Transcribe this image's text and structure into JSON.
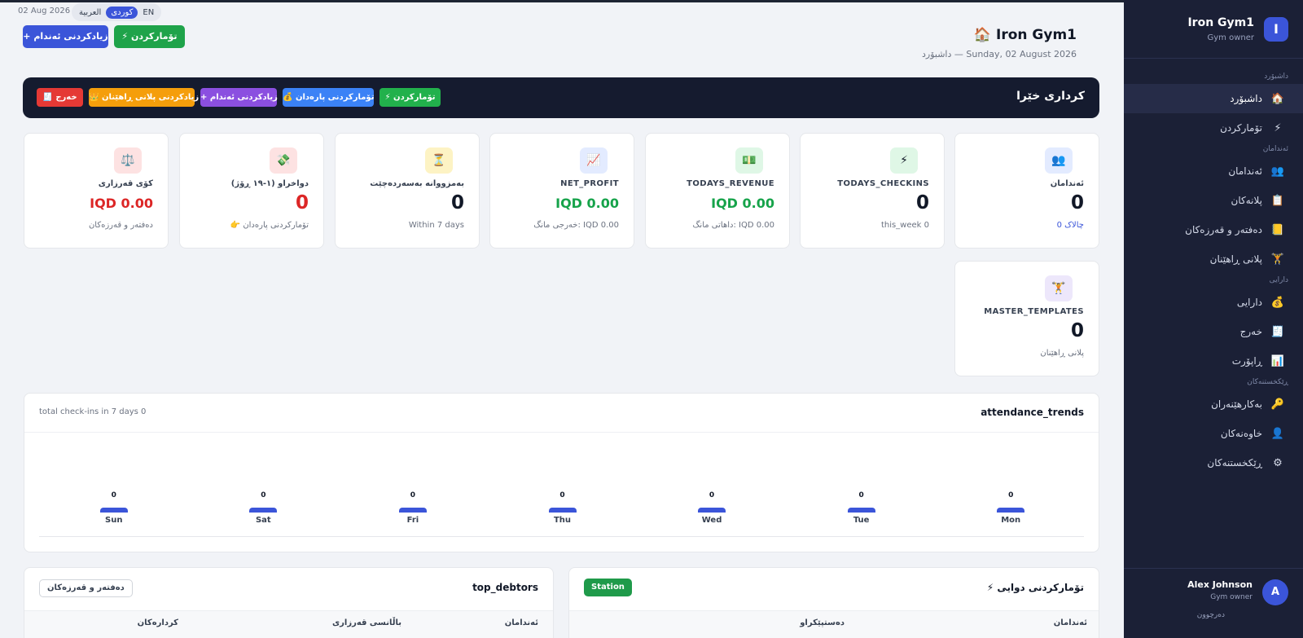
{
  "top": {
    "date": "02 Aug 2026",
    "languages": [
      "العربية",
      "کوردی",
      "EN"
    ],
    "active_language": "کوردی",
    "add_member_button": "+ زیادکردنی ئەندام",
    "checkin_button": "⚡ تۆمارکردن"
  },
  "header": {
    "title": "🏠 Iron Gym1",
    "subtitle": "داشبۆرد — Sunday, 02 August 2026"
  },
  "quick_actions": {
    "title": "کرداری خێرا",
    "buttons": [
      {
        "label": "⚡ تۆمارکردن",
        "color": "#22b14c"
      },
      {
        "label": "💰 تۆمارکردنی پارەدان",
        "color": "#3b82f6"
      },
      {
        "label": "+ زیادکردنی ئەندام",
        "color": "#8b4fe0"
      },
      {
        "label": "👑 زیادکردنی پلانی ڕاهێنان",
        "color": "#f59e0b"
      },
      {
        "label": "🧾 خەرج",
        "color": "#e53935"
      }
    ]
  },
  "stats": [
    {
      "icon": "👥",
      "label": "ئەندامان",
      "value": "0",
      "sub": "0 چالاک",
      "icon_bg": "#e3ebff",
      "color": "#111827"
    },
    {
      "icon": "⚡",
      "label": "TODAYS_CHECKINS",
      "value": "0",
      "sub": "this_week 0",
      "icon_bg": "#dff7e6",
      "color": "#111827"
    },
    {
      "icon": "💵",
      "label": "TODAYS_REVENUE",
      "value": "IQD 0.00",
      "sub": "داهاتی مانگ: IQD 0.00",
      "icon_bg": "#dff7e6",
      "color": "#16a34a"
    },
    {
      "icon": "📈",
      "label": "NET_PROFIT",
      "value": "IQD 0.00",
      "sub": "خەرجی مانگ: IQD 0.00",
      "icon_bg": "#e3ebff",
      "color": "#16a34a"
    },
    {
      "icon": "⏳",
      "label": "بەمزووانە بەسەردەچێت",
      "value": "0",
      "sub": "Within 7 days",
      "icon_bg": "#fdf3c4",
      "color": "#111827"
    },
    {
      "icon": "💸",
      "label": "دواخراو (۱-۱۹ ڕۆژ)",
      "value": "0",
      "sub": "👉 تۆمارکردنی پارەدان",
      "icon_bg": "#fde2e2",
      "color": "#dc2626"
    },
    {
      "icon": "⚖️",
      "label": "کۆی قەرزاری",
      "value": "IQD 0.00",
      "sub": "دەفتەر و قەرزەکان",
      "icon_bg": "#fde2e2",
      "color": "#dc2626"
    },
    {
      "icon": "🏋",
      "label": "MASTER_TEMPLATES",
      "value": "0",
      "sub": "پلانی ڕاهێنان",
      "icon_bg": "#ede7fb",
      "color": "#111827"
    }
  ],
  "attendance": {
    "title": "attendance_trends",
    "note": "total check-ins in 7 days 0"
  },
  "chart_data": {
    "type": "bar",
    "title": "attendance_trends",
    "categories": [
      "Mon",
      "Tue",
      "Wed",
      "Thu",
      "Fri",
      "Sat",
      "Sun"
    ],
    "values": [
      0,
      0,
      0,
      0,
      0,
      0,
      0
    ]
  },
  "recent_checkins": {
    "title": "⚡ تۆمارکردنی دوایی",
    "badge": "Station",
    "columns": [
      "ئەندامان",
      "دەستپێکراو"
    ]
  },
  "top_debtors": {
    "title": "top_debtors",
    "button": "دەفتەر و قەرزەکان",
    "columns": [
      "ئەندامان",
      "باڵانسی قەرزاری",
      "کردارەکان"
    ]
  },
  "sidebar": {
    "brand": "Iron Gym1",
    "role": "Gym owner",
    "logo_letter": "I",
    "sections": [
      {
        "title": "داشبۆرد",
        "items": [
          {
            "label": "داشبۆرد",
            "icon": "🏠",
            "active": true
          },
          {
            "label": "تۆمارکردن",
            "icon": "⚡"
          }
        ]
      },
      {
        "title": "ئەندامان",
        "items": [
          {
            "label": "ئەندامان",
            "icon": "👥"
          },
          {
            "label": "پلانەکان",
            "icon": "📋"
          },
          {
            "label": "دەفتەر و قەرزەکان",
            "icon": "📒"
          },
          {
            "label": "پلانی ڕاهێنان",
            "icon": "🏋"
          }
        ]
      },
      {
        "title": "دارایی",
        "items": [
          {
            "label": "دارایی",
            "icon": "💰"
          },
          {
            "label": "خەرج",
            "icon": "🧾"
          },
          {
            "label": "ڕاپۆرت",
            "icon": "📊"
          }
        ]
      },
      {
        "title": "ڕێکخستنەکان",
        "items": [
          {
            "label": "بەکارهێنەران",
            "icon": "🔑"
          },
          {
            "label": "خاوەنەکان",
            "icon": "👤"
          },
          {
            "label": "ڕێکخستنەکان",
            "icon": "⚙"
          }
        ]
      }
    ],
    "user": {
      "name": "Alex Johnson",
      "role": "Gym owner",
      "initial": "A",
      "logout": "دەرچوون"
    }
  }
}
